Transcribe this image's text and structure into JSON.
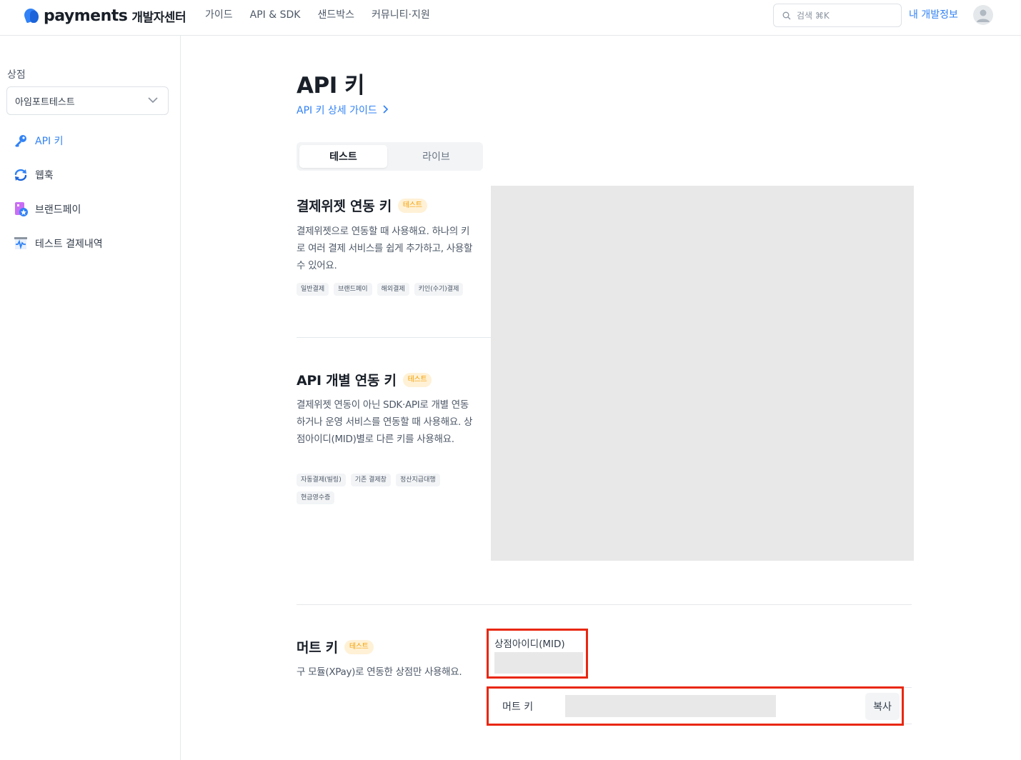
{
  "header": {
    "logo_text": "payments",
    "logo_sub": "개발자센터",
    "nav": [
      "가이드",
      "API & SDK",
      "샌드박스",
      "커뮤니티·지원"
    ],
    "search_placeholder": "검색 ⌘K",
    "my_dev": "내 개발정보",
    "accent_color": "#3182f6"
  },
  "sidebar": {
    "store_label": "상점",
    "store_selected": "아임포트테스트",
    "items": [
      {
        "label": "API 키",
        "icon": "key-icon",
        "active": true
      },
      {
        "label": "웹훅",
        "icon": "refresh-icon",
        "active": false
      },
      {
        "label": "브랜드페이",
        "icon": "brandpay-icon",
        "active": false
      },
      {
        "label": "테스트 결제내역",
        "icon": "receipt-icon",
        "active": false
      }
    ]
  },
  "main": {
    "title": "API 키",
    "guide_link": "API 키 상세 가이드",
    "tabs": [
      {
        "label": "테스트",
        "selected": true
      },
      {
        "label": "라이브",
        "selected": false
      }
    ],
    "widget": {
      "title": "결제위젯 연동 키",
      "badge": "테스트",
      "desc": "결제위젯으로 연동할 때 사용해요. 하나의 키로 여러 결제 서비스를 쉽게 추가하고, 사용할 수 있어요.",
      "chips": [
        "일반결제",
        "브랜드페이",
        "해외결제",
        "키인(수기)결제"
      ]
    },
    "api": {
      "title": "API 개별 연동 키",
      "badge": "테스트",
      "desc": "결제위젯 연동이 아닌 SDK·API로 개별 연동하거나 운영 서비스를 연동할 때 사용해요. 상점아이디(MID)별로 다른 키를 사용해요.",
      "chips": [
        "자동결제(빌링)",
        "기존 결제창",
        "정산지급대행",
        "현금영수증"
      ]
    },
    "mert": {
      "title": "머트 키",
      "badge": "테스트",
      "desc": "구 모듈(XPay)로 연동한 상점만 사용해요.",
      "mid_label": "상점아이디(MID)",
      "key_label": "머트 키",
      "copy": "복사"
    }
  }
}
